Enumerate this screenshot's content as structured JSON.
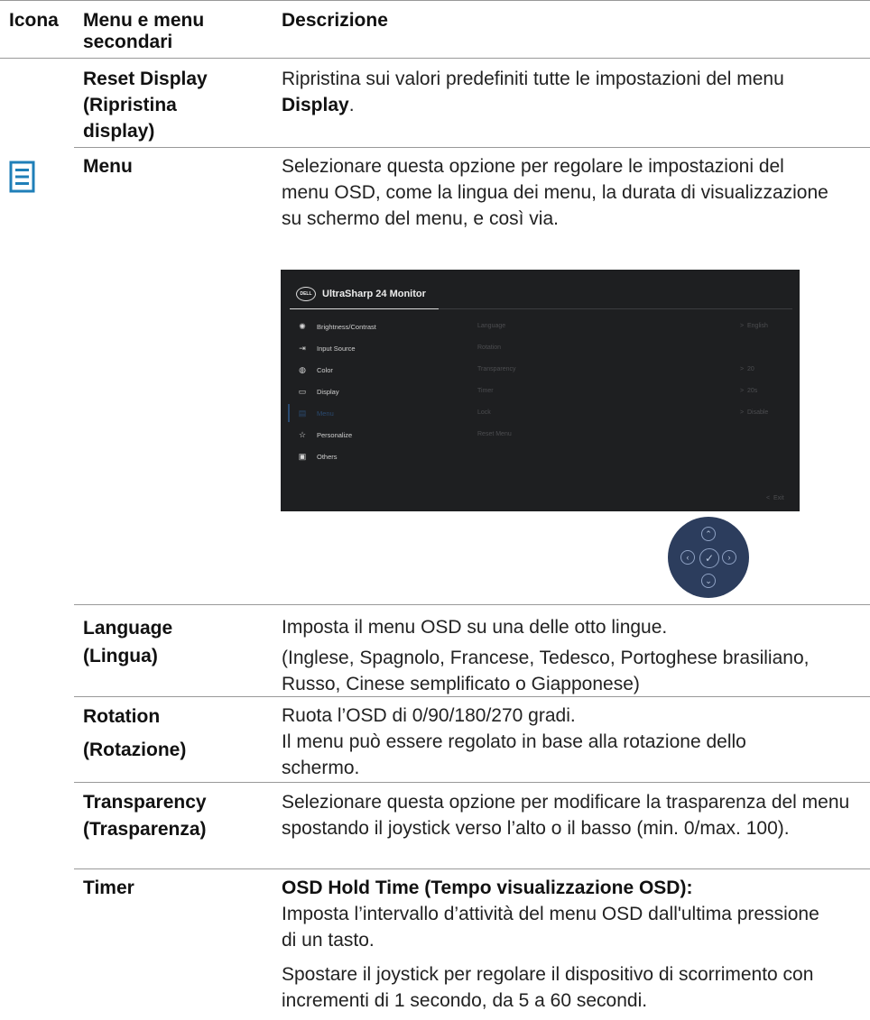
{
  "header": {
    "col_icon": "Icona",
    "col_menu_line1": "Menu e menu",
    "col_menu_line2": "secondari",
    "col_desc": "Descrizione"
  },
  "rows": {
    "reset_display": {
      "label_line1": "Reset Display",
      "label_line2": "(Ripristina",
      "label_line3": "display)",
      "desc_pre": "Ripristina sui valori predefiniti tutte le impostazioni del menu ",
      "desc_bold": "Display",
      "desc_post": "."
    },
    "menu": {
      "label": "Menu",
      "desc": "Selezionare questa opzione per regolare le impostazioni del menu OSD, come la lingua dei menu, la durata di visualizzazione su schermo del menu, e così via."
    },
    "language": {
      "label_line1": "Language",
      "label_line2": "(Lingua)",
      "desc_line1": "Imposta il menu OSD su una delle otto lingue.",
      "desc_line2": "(Inglese, Spagnolo, Francese, Tedesco, Portoghese brasiliano, Russo, Cinese semplificato o Giapponese)"
    },
    "rotation": {
      "label_line1": "Rotation",
      "label_line2": "(Rotazione)",
      "desc_line1": "Ruota l’OSD di 0/90/180/270 gradi.",
      "desc_line2": "Il menu può essere regolato in base alla rotazione dello schermo."
    },
    "transparency": {
      "label_line1": "Transparency",
      "label_line2": "(Trasparenza)",
      "desc": "Selezionare questa opzione per modificare la trasparenza del menu spostando il joystick verso l’alto o il basso (min. 0/max. 100)."
    },
    "timer": {
      "label": "Timer",
      "desc_heading": "OSD Hold Time (Tempo visualizzazione OSD):",
      "desc_line1": "Imposta l’intervallo d’attività del menu OSD dall'ultima pressione di un tasto.",
      "desc_line2": "Spostare il joystick per regolare il dispositivo di scorrimento con incrementi di 1 secondo, da 5 a 60 secondi."
    }
  },
  "osd": {
    "logo": "DELL",
    "title": "UltraSharp 24 Monitor",
    "menu_items": [
      {
        "label": "Brightness/Contrast",
        "icon": "sun-icon"
      },
      {
        "label": "Input Source",
        "icon": "input-icon"
      },
      {
        "label": "Color",
        "icon": "palette-icon"
      },
      {
        "label": "Display",
        "icon": "monitor-icon"
      },
      {
        "label": "Menu",
        "icon": "menu-icon"
      },
      {
        "label": "Personalize",
        "icon": "star-icon"
      },
      {
        "label": "Others",
        "icon": "others-icon"
      }
    ],
    "submenu": [
      {
        "label": "Language",
        "value": "English"
      },
      {
        "label": "Rotation",
        "value": ""
      },
      {
        "label": "Transparency",
        "value": "20"
      },
      {
        "label": "Timer",
        "value": "20s"
      },
      {
        "label": "Lock",
        "value": "Disable"
      },
      {
        "label": "Reset Menu",
        "value": ""
      }
    ],
    "exit": "Exit"
  },
  "colors": {
    "accent_icon": "#1f7fb8",
    "osd_bg": "#1e1f21",
    "joystick_bg": "#2c3d5d"
  }
}
